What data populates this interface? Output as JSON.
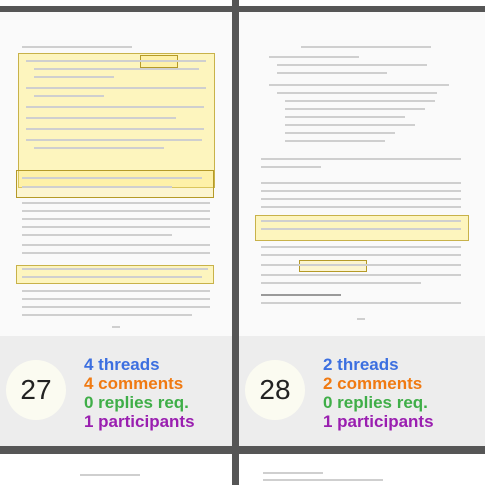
{
  "cells": [
    {
      "page_number": "27",
      "threads": "4 threads",
      "comments": "4 comments",
      "replies": "0 replies req.",
      "participants": "1 participants",
      "footer_page": "27"
    },
    {
      "page_number": "28",
      "threads": "2 threads",
      "comments": "2 comments",
      "replies": "0 replies req.",
      "participants": "1 participants",
      "footer_page": "28"
    }
  ],
  "colors": {
    "threads": "#3c6fe0",
    "comments": "#f07a12",
    "replies": "#3fae48",
    "participants": "#9a1fb0"
  }
}
